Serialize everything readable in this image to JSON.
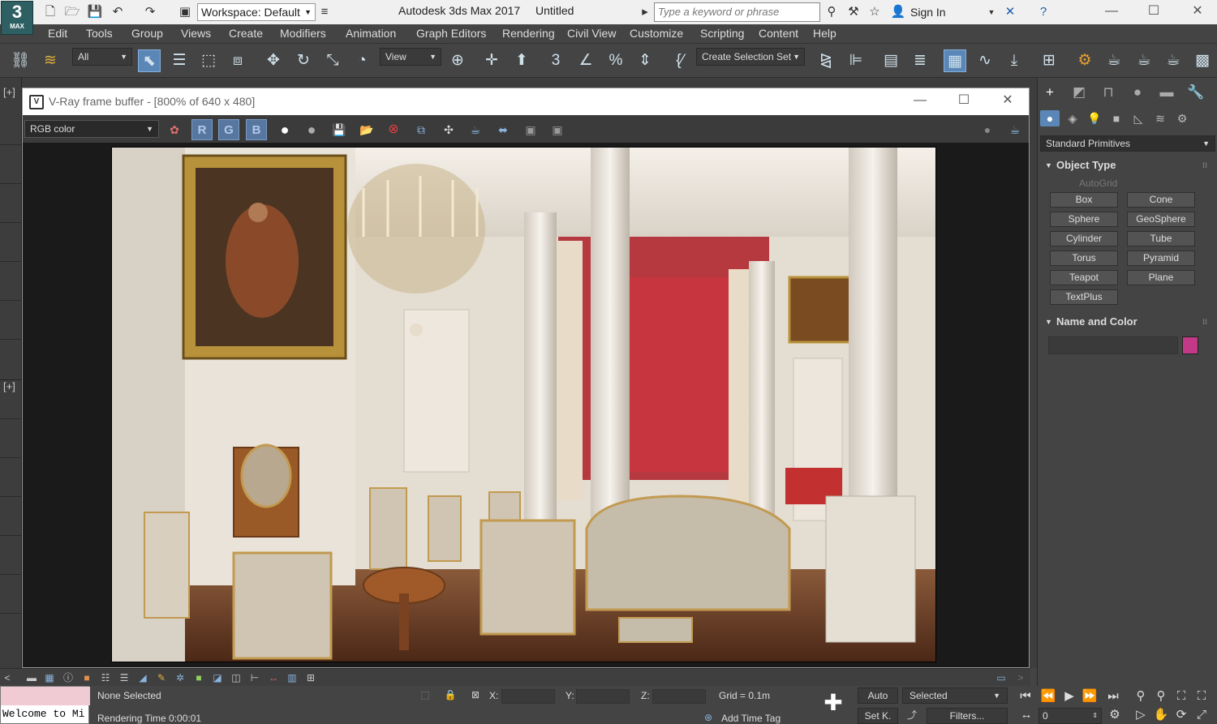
{
  "app": {
    "logo_number": "3",
    "logo_text": "MAX",
    "title": "Autodesk 3ds Max 2017",
    "document": "Untitled"
  },
  "workspace": {
    "label": "Workspace: Default"
  },
  "search": {
    "placeholder": "Type a keyword or phrase"
  },
  "signin": {
    "label": "Sign In"
  },
  "menu": [
    "Edit",
    "Tools",
    "Group",
    "Views",
    "Create",
    "Modifiers",
    "Animation",
    "Graph Editors",
    "Rendering",
    "Civil View",
    "Customize",
    "Scripting",
    "Content",
    "Help"
  ],
  "toolbar": {
    "filter": "All",
    "refcoord": "View",
    "selection_set": "Create Selection Set"
  },
  "viewport": {
    "label_top": "[+]",
    "label_bottom": "[+]"
  },
  "vfb": {
    "title": "V-Ray frame buffer - [800% of 640 x 480]",
    "channel": "RGB color",
    "r": "R",
    "g": "G",
    "b": "B"
  },
  "command_panel": {
    "dropdown": "Standard Primitives",
    "object_type": {
      "title": "Object Type",
      "autogrid": "AutoGrid",
      "buttons": [
        "Box",
        "Cone",
        "Sphere",
        "GeoSphere",
        "Cylinder",
        "Tube",
        "Torus",
        "Pyramid",
        "Teapot",
        "Plane",
        "TextPlus"
      ]
    },
    "name_color": {
      "title": "Name and Color",
      "swatch": "#c23a87"
    }
  },
  "status": {
    "maxscript": "Welcome to Mi",
    "selection": "None Selected",
    "render_time": "Rendering Time  0:00:01",
    "x_label": "X:",
    "y_label": "Y:",
    "z_label": "Z:",
    "grid": "Grid = 0.1m",
    "add_time_tag": "Add Time Tag",
    "auto": "Auto",
    "set_key": "Set K.",
    "selected": "Selected",
    "filters": "Filters...",
    "frame": "0"
  }
}
